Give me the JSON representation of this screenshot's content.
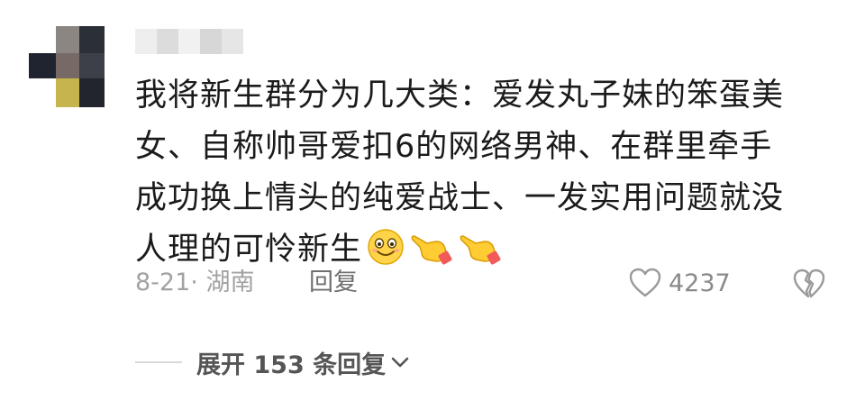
{
  "comment": {
    "text_lines": [
      "我将新生群分为几大类：爱发丸子妹的笨蛋美",
      "女、自称帅哥爱扣6的网络男神、在群里牵手",
      "成功换上情头的纯爱战士、一发实用问题就没",
      "人理的可怜新生"
    ],
    "emojis": [
      "smile-emoji",
      "pointing-hand-emoji",
      "pointing-hand-emoji"
    ]
  },
  "meta": {
    "date_location": "8-21· 湖南",
    "reply_label": "回复",
    "like_count": "4237"
  },
  "expand": {
    "label": "展开 153 条回复"
  },
  "colors": {
    "text": "#1b1b1b",
    "meta": "#a2a2a2",
    "icon": "#9a9a9a"
  }
}
